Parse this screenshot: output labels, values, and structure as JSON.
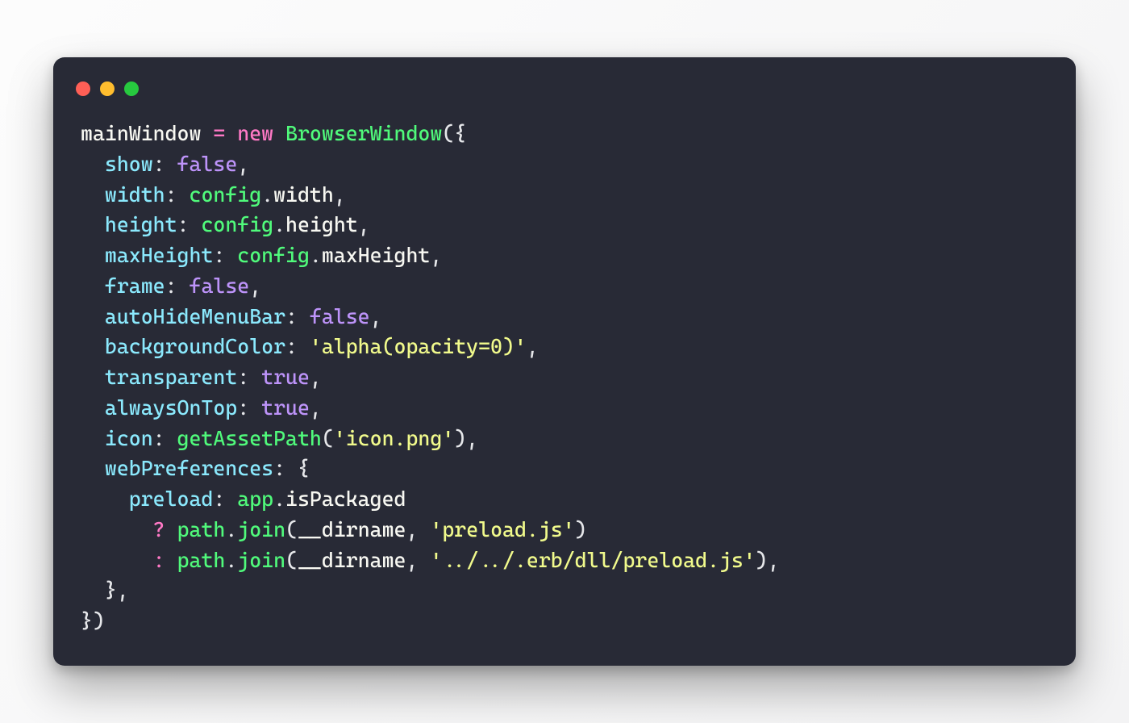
{
  "dots": {
    "red": "#ff5f56",
    "yellow": "#ffbd2e",
    "green": "#27c93f"
  },
  "code": {
    "l1": {
      "a": "mainWindow ",
      "eq": "=",
      "sp": " ",
      "new": "new",
      "sp2": " ",
      "cls": "BrowserWindow",
      "open": "({"
    },
    "l2": {
      "indent": "  ",
      "key": "show",
      "colon": ": ",
      "val": "false",
      "comma": ","
    },
    "l3": {
      "indent": "  ",
      "key": "width",
      "colon": ": ",
      "a": "config",
      "dot": ".",
      "b": "width",
      "comma": ","
    },
    "l4": {
      "indent": "  ",
      "key": "height",
      "colon": ": ",
      "a": "config",
      "dot": ".",
      "b": "height",
      "comma": ","
    },
    "l5": {
      "indent": "  ",
      "key": "maxHeight",
      "colon": ": ",
      "a": "config",
      "dot": ".",
      "b": "maxHeight",
      "comma": ","
    },
    "l6": {
      "indent": "  ",
      "key": "frame",
      "colon": ": ",
      "val": "false",
      "comma": ","
    },
    "l7": {
      "indent": "  ",
      "key": "autoHideMenuBar",
      "colon": ": ",
      "val": "false",
      "comma": ","
    },
    "l8": {
      "indent": "  ",
      "key": "backgroundColor",
      "colon": ": ",
      "str": "'alpha(opacity=0)'",
      "comma": ","
    },
    "l9": {
      "indent": "  ",
      "key": "transparent",
      "colon": ": ",
      "val": "true",
      "comma": ","
    },
    "l10": {
      "indent": "  ",
      "key": "alwaysOnTop",
      "colon": ": ",
      "val": "true",
      "comma": ","
    },
    "l11": {
      "indent": "  ",
      "key": "icon",
      "colon": ": ",
      "fn": "getAssetPath",
      "open": "(",
      "str": "'icon.png'",
      "close": ")",
      "comma": ","
    },
    "l12": {
      "indent": "  ",
      "key": "webPreferences",
      "colon": ": ",
      "brace": "{"
    },
    "l13": {
      "indent": "    ",
      "key": "preload",
      "colon": ": ",
      "a": "app",
      "dot": ".",
      "b": "isPackaged"
    },
    "l14": {
      "indent": "      ",
      "op": "?",
      "sp": " ",
      "a": "path",
      "dot": ".",
      "fn": "join",
      "open": "(",
      "arg1": "__dirname",
      "comma1": ", ",
      "str": "'preload.js'",
      "close": ")"
    },
    "l15": {
      "indent": "      ",
      "op": ":",
      "sp": " ",
      "a": "path",
      "dot": ".",
      "fn": "join",
      "open": "(",
      "arg1": "__dirname",
      "comma1": ", ",
      "str": "'../../.erb/dll/preload.js'",
      "close": ")",
      "comma": ","
    },
    "l16": {
      "indent": "  ",
      "brace": "},"
    },
    "l17": {
      "close": "})"
    }
  }
}
